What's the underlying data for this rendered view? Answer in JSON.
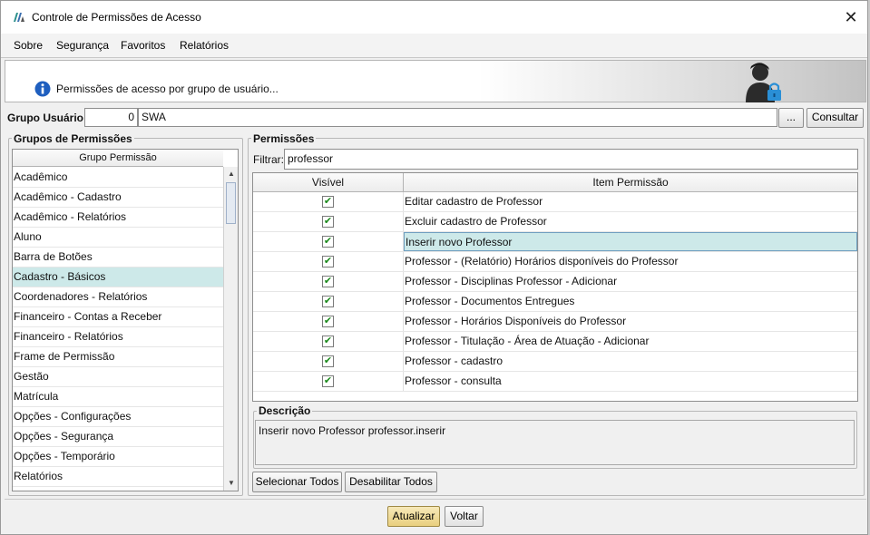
{
  "window": {
    "title": "Controle de Permissões de Acesso",
    "close_glyph": "✕"
  },
  "menu": {
    "items": [
      {
        "label": "Sobre"
      },
      {
        "label": "Segurança"
      },
      {
        "label": "Favoritos"
      },
      {
        "label": "Relatórios"
      }
    ]
  },
  "banner": {
    "text": "Permissões de acesso por grupo de usuário...",
    "icons": [
      "info-icon",
      "user-lock-icon"
    ]
  },
  "grupo_usuario": {
    "label": "Grupo Usuário:",
    "code": "0",
    "name": "SWA",
    "browse_label": "...",
    "consultar_label": "Consultar"
  },
  "grupos": {
    "legend": "Grupos de Permissões",
    "column_header": "Grupo Permissão",
    "items": [
      {
        "label": "Acadêmico",
        "selected": false
      },
      {
        "label": "Acadêmico - Cadastro",
        "selected": false
      },
      {
        "label": "Acadêmico - Relatórios",
        "selected": false
      },
      {
        "label": "Aluno",
        "selected": false
      },
      {
        "label": "Barra de Botões",
        "selected": false
      },
      {
        "label": "Cadastro - Básicos",
        "selected": true
      },
      {
        "label": "Coordenadores - Relatórios",
        "selected": false
      },
      {
        "label": "Financeiro - Contas a Receber",
        "selected": false
      },
      {
        "label": "Financeiro - Relatórios",
        "selected": false
      },
      {
        "label": "Frame de Permissão",
        "selected": false
      },
      {
        "label": "Gestão",
        "selected": false
      },
      {
        "label": "Matrícula",
        "selected": false
      },
      {
        "label": "Opções - Configurações",
        "selected": false
      },
      {
        "label": "Opções - Segurança",
        "selected": false
      },
      {
        "label": "Opções - Temporário",
        "selected": false
      },
      {
        "label": "Relatórios",
        "selected": false
      }
    ]
  },
  "permissoes": {
    "legend": "Permissões",
    "filter_label": "Filtrar:",
    "filter_value": "professor",
    "columns": [
      "Visível",
      "Item Permissão"
    ],
    "rows": [
      {
        "visible": true,
        "item": "Editar cadastro de Professor",
        "selected": false
      },
      {
        "visible": true,
        "item": "Excluir cadastro de Professor",
        "selected": false
      },
      {
        "visible": true,
        "item": "Inserir novo Professor",
        "selected": true
      },
      {
        "visible": true,
        "item": "Professor - (Relatório) Horários disponíveis do Professor",
        "selected": false
      },
      {
        "visible": true,
        "item": "Professor - Disciplinas Professor - Adicionar",
        "selected": false
      },
      {
        "visible": true,
        "item": "Professor - Documentos Entregues",
        "selected": false
      },
      {
        "visible": true,
        "item": "Professor - Horários Disponíveis do Professor",
        "selected": false
      },
      {
        "visible": true,
        "item": "Professor - Titulação - Área de Atuação - Adicionar",
        "selected": false
      },
      {
        "visible": true,
        "item": "Professor - cadastro",
        "selected": false
      },
      {
        "visible": true,
        "item": "Professor - consulta",
        "selected": false
      }
    ],
    "check_glyph": "✔"
  },
  "descricao": {
    "legend": "Descrição",
    "text": "Inserir novo Professor professor.inserir"
  },
  "actions": {
    "select_all": "Selecionar Todos",
    "disable_all": "Desabilitar Todos",
    "update": "Atualizar",
    "back": "Voltar"
  }
}
